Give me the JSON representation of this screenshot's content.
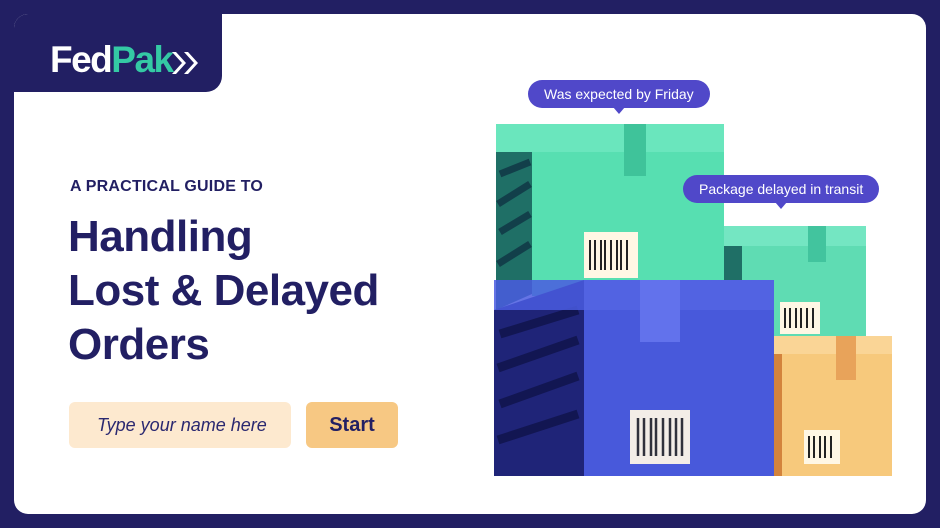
{
  "brand": {
    "logo_part1": "Fed",
    "logo_part2": "Pak",
    "primary_color": "#221f63",
    "accent_color": "#34c9a4"
  },
  "hero": {
    "eyebrow": "A PRACTICAL GUIDE TO",
    "title_line1": "Handling",
    "title_line2": "Lost & Delayed",
    "title_line3": "Orders"
  },
  "form": {
    "name_placeholder": "Type your name here",
    "start_label": "Start"
  },
  "illustration": {
    "bubble1": "Was expected by Friday",
    "bubble2": "Package delayed in transit",
    "bubble_color": "#5048c9"
  }
}
